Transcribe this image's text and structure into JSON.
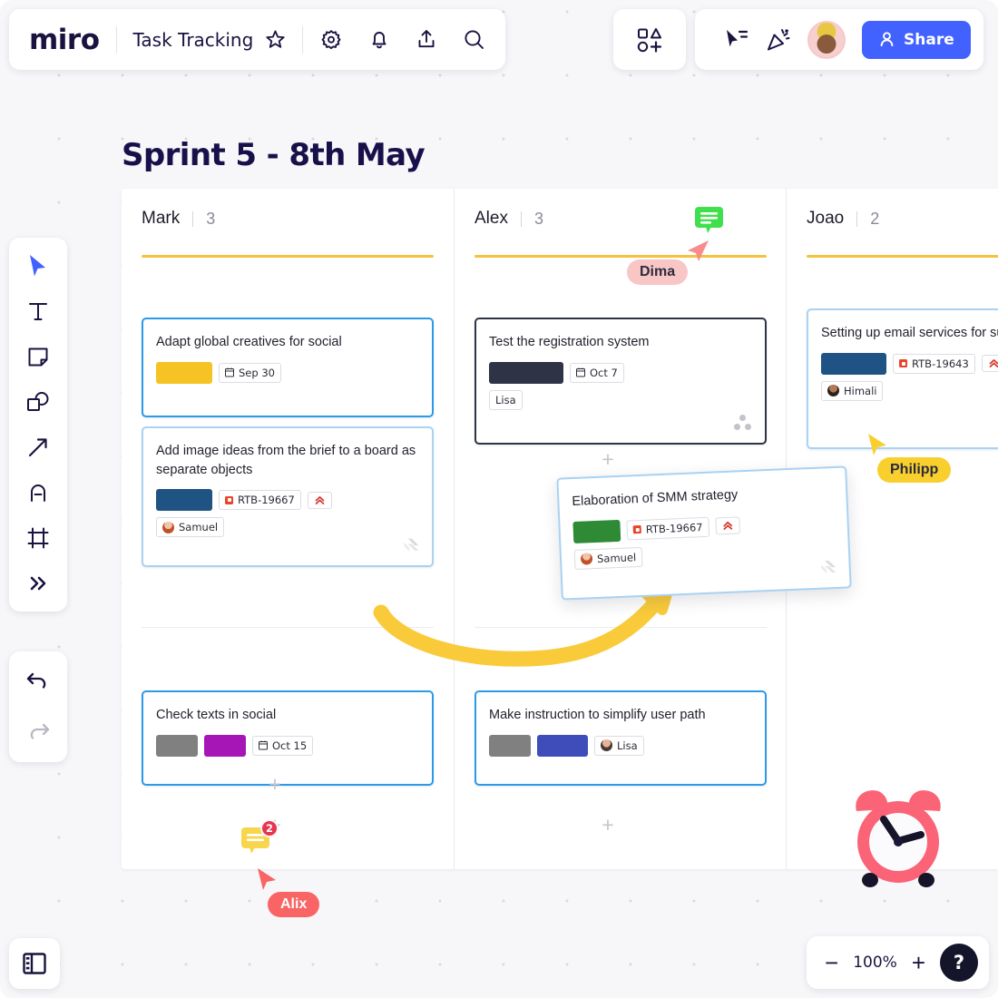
{
  "app": {
    "logo": "miro",
    "doc_title": "Task Tracking",
    "share_label": "Share",
    "icons": {
      "star": "star-icon",
      "gear": "gear-icon",
      "bell": "bell-icon",
      "upload": "upload-icon",
      "search": "search-icon",
      "shapes": "shapes-icon",
      "cursor_share": "cursor-share-icon",
      "celebrate": "celebrate-icon",
      "avatar": "user-avatar"
    }
  },
  "tools": {
    "items": [
      {
        "name": "select-tool",
        "icon": "cursor-icon"
      },
      {
        "name": "text-tool",
        "icon": "text-icon"
      },
      {
        "name": "sticky-tool",
        "icon": "sticky-note-icon"
      },
      {
        "name": "shapes-tool",
        "icon": "shapes-icon"
      },
      {
        "name": "arrow-tool",
        "icon": "arrow-icon"
      },
      {
        "name": "pen-tool",
        "icon": "pen-icon"
      },
      {
        "name": "frame-tool",
        "icon": "frame-icon"
      },
      {
        "name": "more-tools",
        "icon": "chevron-double-right-icon"
      }
    ],
    "history": [
      {
        "name": "undo-button",
        "icon": "undo-icon"
      },
      {
        "name": "redo-button",
        "icon": "redo-icon"
      }
    ]
  },
  "board": {
    "title": "Sprint 5 - 8th May",
    "columns": [
      {
        "name": "Mark",
        "count": "3"
      },
      {
        "name": "Alex",
        "count": "3"
      },
      {
        "name": "Joao",
        "count": "2"
      }
    ]
  },
  "cards": {
    "adapt_global": {
      "title": "Adapt global creatives for social",
      "swatch": "#f5c324",
      "date": "Sep 30"
    },
    "add_image_ideas": {
      "title": "Add image ideas from the brief to a board as separate objects",
      "swatch": "#1e5384",
      "ticket": "RTB-19667",
      "priority": "highest",
      "assignee": "Samuel"
    },
    "check_texts": {
      "title": "Check texts in social",
      "swatch1": "#808080",
      "swatch2": "#a616b7",
      "date": "Oct 15"
    },
    "test_registration": {
      "title": "Test the registration system",
      "swatch": "#2e3446",
      "date": "Oct 7",
      "assignee": "Lisa"
    },
    "smm_strategy": {
      "title": "Elaboration of SMM strategy",
      "swatch": "#2f8a36",
      "ticket": "RTB-19667",
      "priority": "highest",
      "assignee": "Samuel"
    },
    "make_instruction": {
      "title": "Make instruction to simplify user path",
      "swatch1": "#808080",
      "swatch2": "#3f4dbb",
      "assignee": "Lisa"
    },
    "email_services": {
      "title": "Setting up email services for subscription",
      "swatch": "#1e5384",
      "ticket": "RTB-19643",
      "priority": "highest",
      "assignee": "Himali"
    }
  },
  "collaborators": [
    {
      "name": "Dima",
      "color": "#f9c6c6"
    },
    {
      "name": "Philipp",
      "color": "#f9cf2e"
    },
    {
      "name": "Alix",
      "color": "#f96464"
    }
  ],
  "comments": [
    {
      "pin": "green-comment-pin",
      "count": ""
    },
    {
      "pin": "yellow-comment-pin",
      "count": "2"
    }
  ],
  "sticker": {
    "name": "alarm-clock-sticker",
    "color": "#fb6377"
  },
  "footer": {
    "zoom_level": "100%",
    "zoom_out": "−",
    "zoom_in": "+",
    "help": "?",
    "panel": "panels-icon"
  }
}
